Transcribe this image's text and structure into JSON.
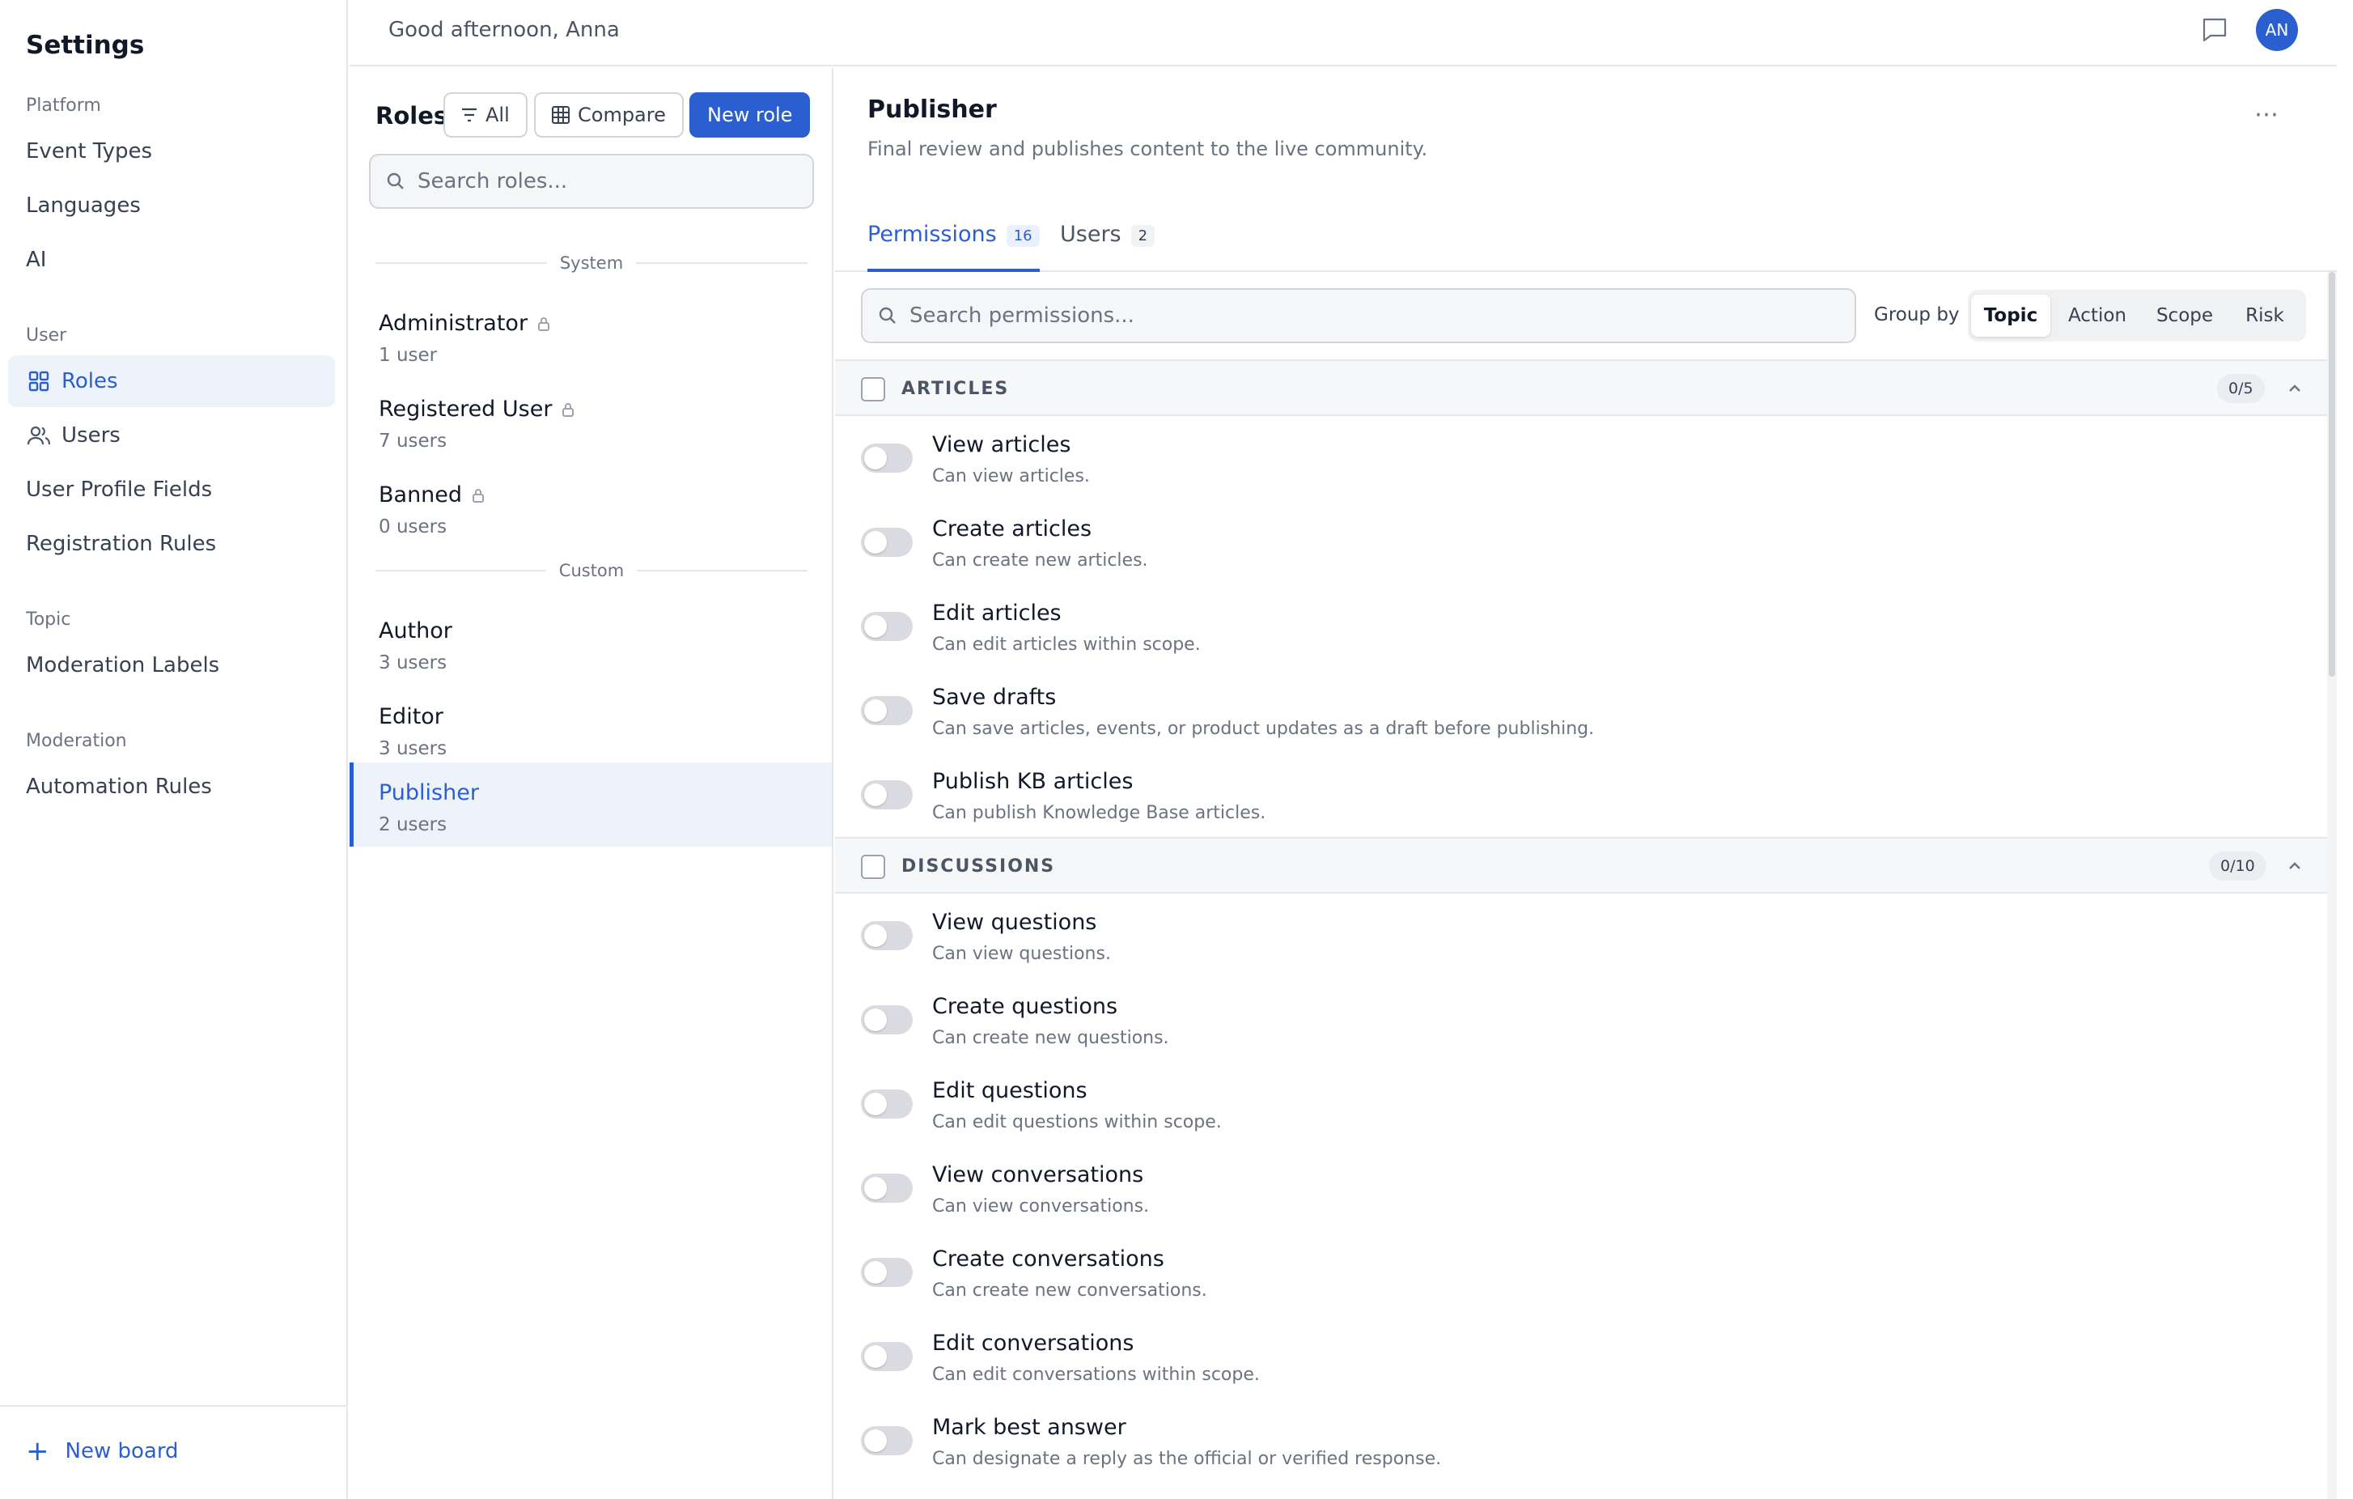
{
  "sidebar": {
    "title": "Settings",
    "sections": [
      {
        "label": "Platform",
        "items": [
          {
            "label": "Event Types"
          },
          {
            "label": "Languages"
          },
          {
            "label": "AI"
          }
        ]
      },
      {
        "label": "User",
        "items": [
          {
            "label": "Roles",
            "icon": "grid-icon",
            "active": true
          },
          {
            "label": "Users",
            "icon": "users-icon"
          },
          {
            "label": "User Profile Fields"
          },
          {
            "label": "Registration Rules"
          }
        ]
      },
      {
        "label": "Topic",
        "items": [
          {
            "label": "Moderation Labels"
          }
        ]
      },
      {
        "label": "Moderation",
        "items": [
          {
            "label": "Automation Rules"
          }
        ]
      }
    ],
    "new_board_label": "New board"
  },
  "topbar": {
    "greeting": "Good afternoon, Anna",
    "avatar_initials": "AN"
  },
  "roles_panel": {
    "title": "Roles",
    "filter_label": "All",
    "compare_label": "Compare",
    "new_role_label": "New role",
    "search_placeholder": "Search roles...",
    "groups": [
      {
        "label": "System",
        "roles": [
          {
            "name": "Administrator",
            "count": "1 user",
            "locked": true
          },
          {
            "name": "Registered User",
            "count": "7 users",
            "locked": true
          },
          {
            "name": "Banned",
            "count": "0 users",
            "locked": true
          }
        ]
      },
      {
        "label": "Custom",
        "roles": [
          {
            "name": "Author",
            "count": "3 users"
          },
          {
            "name": "Editor",
            "count": "3 users"
          },
          {
            "name": "Publisher",
            "count": "2 users",
            "selected": true
          }
        ]
      }
    ]
  },
  "detail": {
    "title": "Publisher",
    "description": "Final review and publishes content to the live community.",
    "tabs": [
      {
        "label": "Permissions",
        "badge": "16",
        "active": true
      },
      {
        "label": "Users",
        "badge": "2"
      }
    ],
    "search_placeholder": "Search permissions...",
    "group_by_label": "Group by",
    "group_by_options": [
      "Topic",
      "Action",
      "Scope",
      "Risk"
    ],
    "group_by_selected": "Topic",
    "permission_groups": [
      {
        "name": "ARTICLES",
        "count": "0/5",
        "permissions": [
          {
            "name": "View articles",
            "desc": "Can view articles."
          },
          {
            "name": "Create articles",
            "desc": "Can create new articles."
          },
          {
            "name": "Edit articles",
            "desc": "Can edit articles within scope."
          },
          {
            "name": "Save drafts",
            "desc": "Can save articles, events, or product updates as a draft before publishing."
          },
          {
            "name": "Publish KB articles",
            "desc": "Can publish Knowledge Base articles."
          }
        ]
      },
      {
        "name": "DISCUSSIONS",
        "count": "0/10",
        "permissions": [
          {
            "name": "View questions",
            "desc": "Can view questions."
          },
          {
            "name": "Create questions",
            "desc": "Can create new questions."
          },
          {
            "name": "Edit questions",
            "desc": "Can edit questions within scope."
          },
          {
            "name": "View conversations",
            "desc": "Can view conversations."
          },
          {
            "name": "Create conversations",
            "desc": "Can create new conversations."
          },
          {
            "name": "Edit conversations",
            "desc": "Can edit conversations within scope."
          },
          {
            "name": "Mark best answer",
            "desc": "Can designate a reply as the official or verified response."
          }
        ]
      }
    ]
  },
  "colors": {
    "accent": "#2b5fcf",
    "selected_bg": "#eef3fb",
    "border": "#e5e7eb"
  }
}
